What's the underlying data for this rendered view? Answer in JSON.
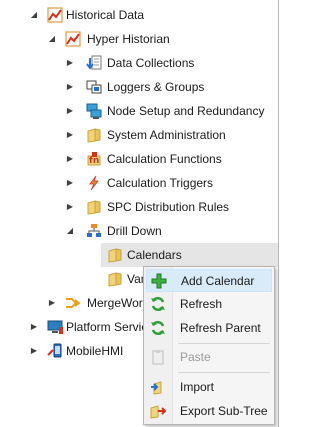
{
  "tree": {
    "historical_data": "Historical Data",
    "hyper_historian": "Hyper Historian",
    "data_collections": "Data Collections",
    "loggers_groups": "Loggers & Groups",
    "node_setup": "Node Setup and Redundancy",
    "system_admin": "System Administration",
    "calc_functions": "Calculation Functions",
    "calc_triggers": "Calculation Triggers",
    "spc_rules": "SPC Distribution Rules",
    "drill_down": "Drill Down",
    "calendars": "Calendars",
    "variables_partial": "Var",
    "mergeworx_partial": "MergeWor",
    "platform_services_partial": "Platform Servic",
    "mobilehmi": "MobileHMI"
  },
  "context_menu": {
    "add_calendar": "Add Calendar",
    "refresh": "Refresh",
    "refresh_parent": "Refresh Parent",
    "paste": "Paste",
    "import": "Import",
    "export_subtree": "Export Sub-Tree"
  },
  "colors": {
    "selected_row": "#e5e5e5",
    "menu_highlight": "#d9ebf9",
    "folder": "#e8c35a",
    "accent_blue": "#2a6fc9"
  }
}
